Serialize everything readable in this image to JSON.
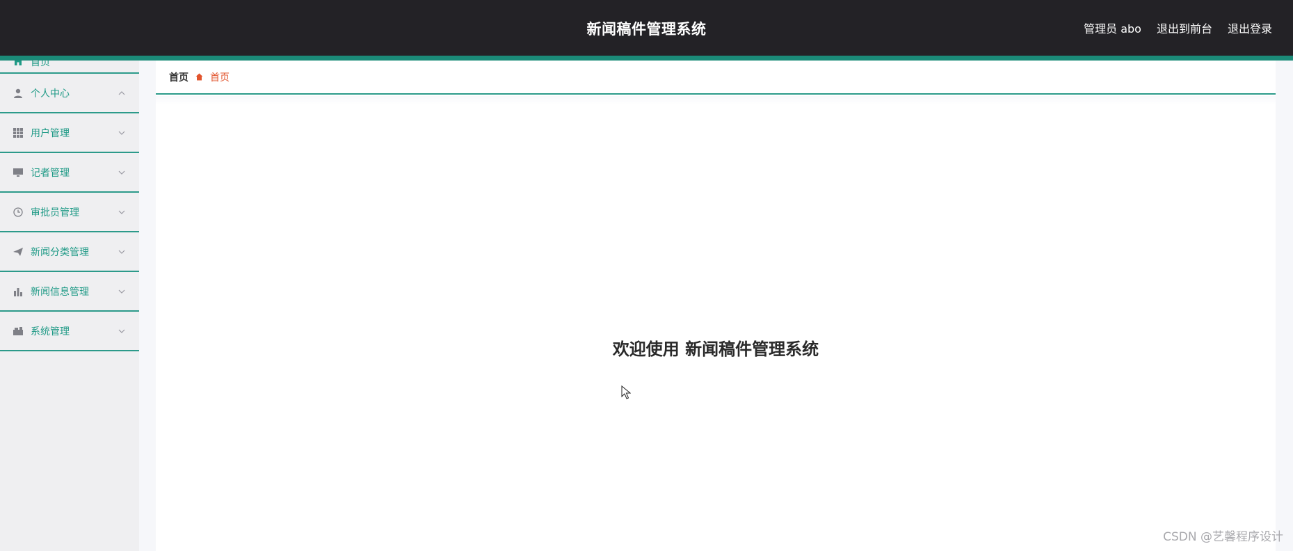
{
  "header": {
    "title": "新闻稿件管理系统",
    "user": "管理员 abo",
    "to_front": "退出到前台",
    "logout": "退出登录"
  },
  "sidebar": {
    "items": [
      {
        "label": "首页",
        "icon": "home-icon"
      },
      {
        "label": "个人中心",
        "icon": "user-icon",
        "chevron": "up"
      },
      {
        "label": "用户管理",
        "icon": "grid-icon",
        "chevron": "down"
      },
      {
        "label": "记者管理",
        "icon": "monitor-icon",
        "chevron": "down"
      },
      {
        "label": "审批员管理",
        "icon": "clock-icon",
        "chevron": "down"
      },
      {
        "label": "新闻分类管理",
        "icon": "send-icon",
        "chevron": "down"
      },
      {
        "label": "新闻信息管理",
        "icon": "bar-chart-icon",
        "chevron": "down"
      },
      {
        "label": "系统管理",
        "icon": "briefcase-icon",
        "chevron": "down"
      }
    ]
  },
  "breadcrumb": {
    "root": "首页",
    "current": "首页"
  },
  "main": {
    "welcome": "欢迎使用 新闻稿件管理系统"
  },
  "watermark": "CSDN @艺馨程序设计",
  "colors": {
    "header_bg": "#232226",
    "accent": "#1b8b78",
    "menu_text": "#1f9a86",
    "breadcrumb_current": "#e2542d"
  }
}
